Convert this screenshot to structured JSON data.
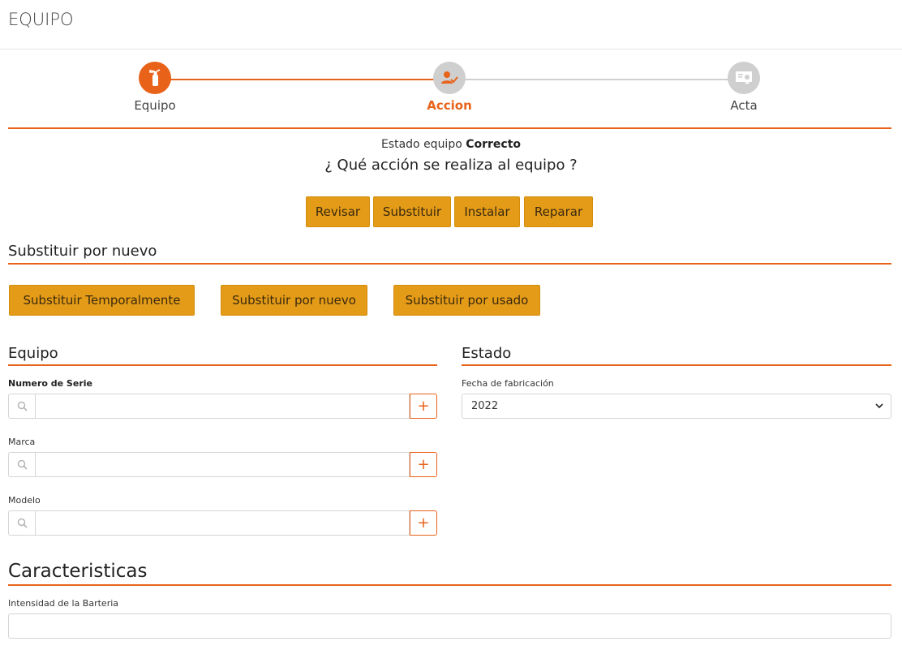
{
  "header": {
    "title": "EQUIPO"
  },
  "stepper": {
    "steps": [
      {
        "label": "Equipo",
        "icon": "fire-extinguisher-icon",
        "state": "done"
      },
      {
        "label": "Accion",
        "icon": "user-check-icon",
        "state": "active"
      },
      {
        "label": "Acta",
        "icon": "certificate-icon",
        "state": "todo"
      }
    ]
  },
  "status": {
    "prefix": "Estado equipo",
    "value": "Correcto"
  },
  "question": "¿ Qué acción se realiza al equipo ?",
  "actions": [
    "Revisar",
    "Substituir",
    "Instalar",
    "Reparar"
  ],
  "substitute": {
    "title": "Substituir por nuevo",
    "options": [
      "Substituir Temporalmente",
      "Substituir por nuevo",
      "Substituir por usado"
    ]
  },
  "equipo": {
    "title": "Equipo",
    "fields": [
      {
        "label": "Numero de Serie",
        "value": "",
        "add": "+"
      },
      {
        "label": "Marca",
        "value": "",
        "add": "+"
      },
      {
        "label": "Modelo",
        "value": "",
        "add": "+"
      }
    ]
  },
  "estado": {
    "title": "Estado",
    "fecha_label": "Fecha de fabricación",
    "fecha_value": "2022"
  },
  "caracteristicas": {
    "title": "Caracteristicas",
    "intensidad_label": "Intensidad de la Barteria",
    "intensidad_value": ""
  },
  "colors": {
    "accent": "#e8621a",
    "button": "#e49b17",
    "inactive": "#cfcfcf"
  }
}
